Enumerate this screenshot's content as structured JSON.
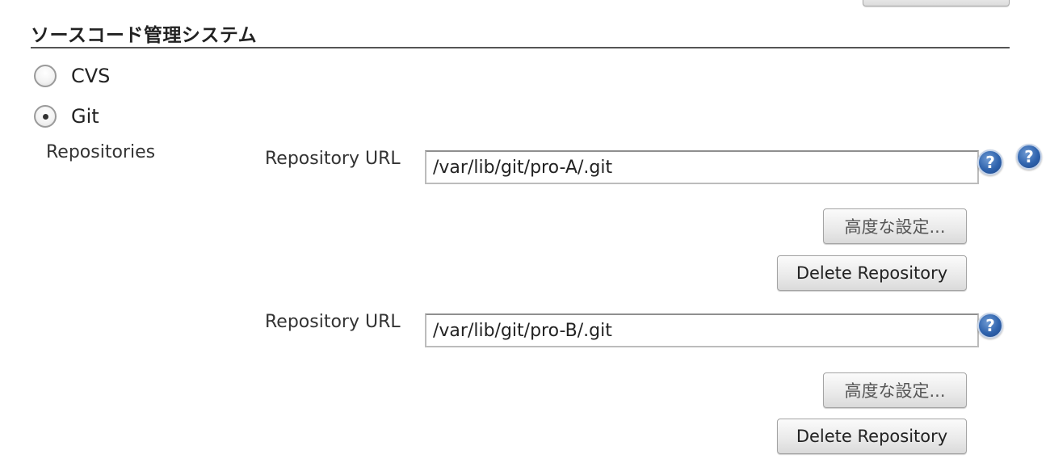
{
  "section": {
    "title": "ソースコード管理システム"
  },
  "scm_options": [
    {
      "label": "CVS",
      "checked": false
    },
    {
      "label": "Git",
      "checked": true
    }
  ],
  "repositories_label": "Repositories",
  "repositories": [
    {
      "url_label": "Repository URL",
      "url_value": "/var/lib/git/pro-A/.git",
      "advanced_label": "高度な設定...",
      "delete_label": "Delete Repository"
    },
    {
      "url_label": "Repository URL",
      "url_value": "/var/lib/git/pro-B/.git",
      "advanced_label": "高度な設定...",
      "delete_label": "Delete Repository"
    }
  ],
  "help_icon_glyph": "?",
  "colors": {
    "help_icon": "#2f63ad",
    "rule": "#555555"
  }
}
